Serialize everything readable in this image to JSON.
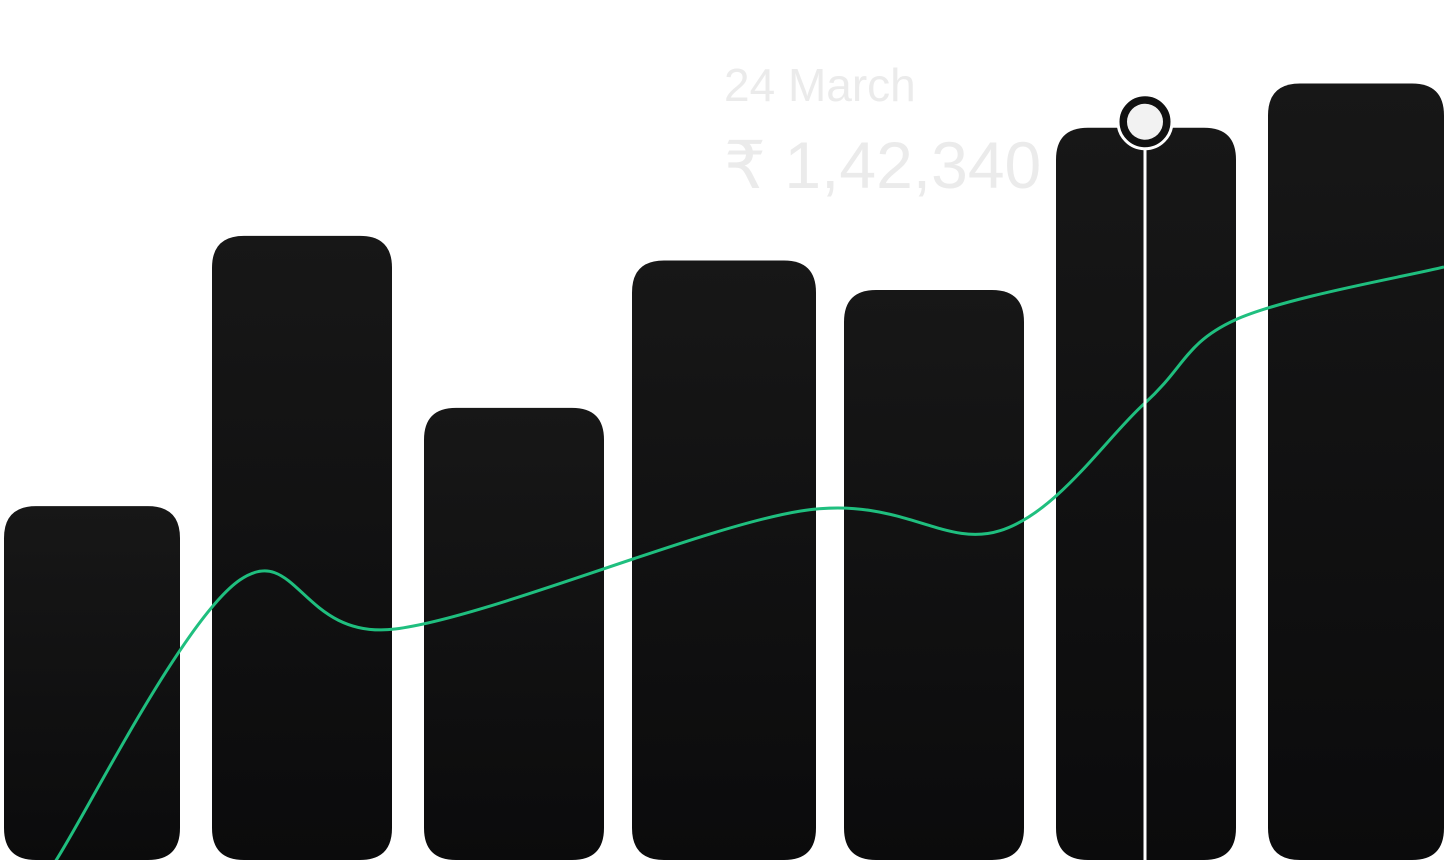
{
  "chart_data": {
    "type": "bar",
    "bar_color": "#111111",
    "line_color": "#1fbf7f",
    "tooltip_color": "#ebebeb",
    "bars": {
      "values": [
        72,
        127,
        92,
        122,
        116,
        149,
        158
      ]
    },
    "line": {
      "values": [
        29,
        57,
        47,
        71,
        67,
        93
      ]
    },
    "ylim": [
      0,
      175
    ],
    "highlight_index": 5,
    "tooltip": {
      "date": "24 March",
      "value": "₹ 1,42,340"
    }
  }
}
